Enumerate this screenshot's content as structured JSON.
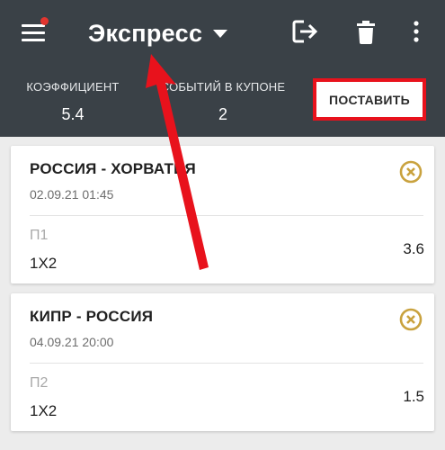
{
  "header": {
    "title": "Экспресс",
    "coefficient_label": "КОЭФФИЦИЕНТ",
    "coefficient_value": "5.4",
    "events_label": "СОБЫТИЙ В КУПОНЕ",
    "events_value": "2",
    "place_button": "ПОСТАВИТЬ",
    "icons": [
      "menu-icon",
      "logout-icon",
      "trash-icon",
      "more-vertical-icon"
    ]
  },
  "coupons": [
    {
      "match": "РОССИЯ - ХОРВАТИЯ",
      "datetime": "02.09.21 01:45",
      "outcome": "П1",
      "market": "1X2",
      "odds": "3.6"
    },
    {
      "match": "КИПР - РОССИЯ",
      "datetime": "04.09.21 20:00",
      "outcome": "П2",
      "market": "1X2",
      "odds": "1.5"
    }
  ],
  "colors": {
    "header_bg": "#3a4147",
    "page_bg": "#ececec",
    "remove_icon": "#c9a23e",
    "annotation_red": "#e8121c",
    "notification_dot": "#e2352f"
  }
}
